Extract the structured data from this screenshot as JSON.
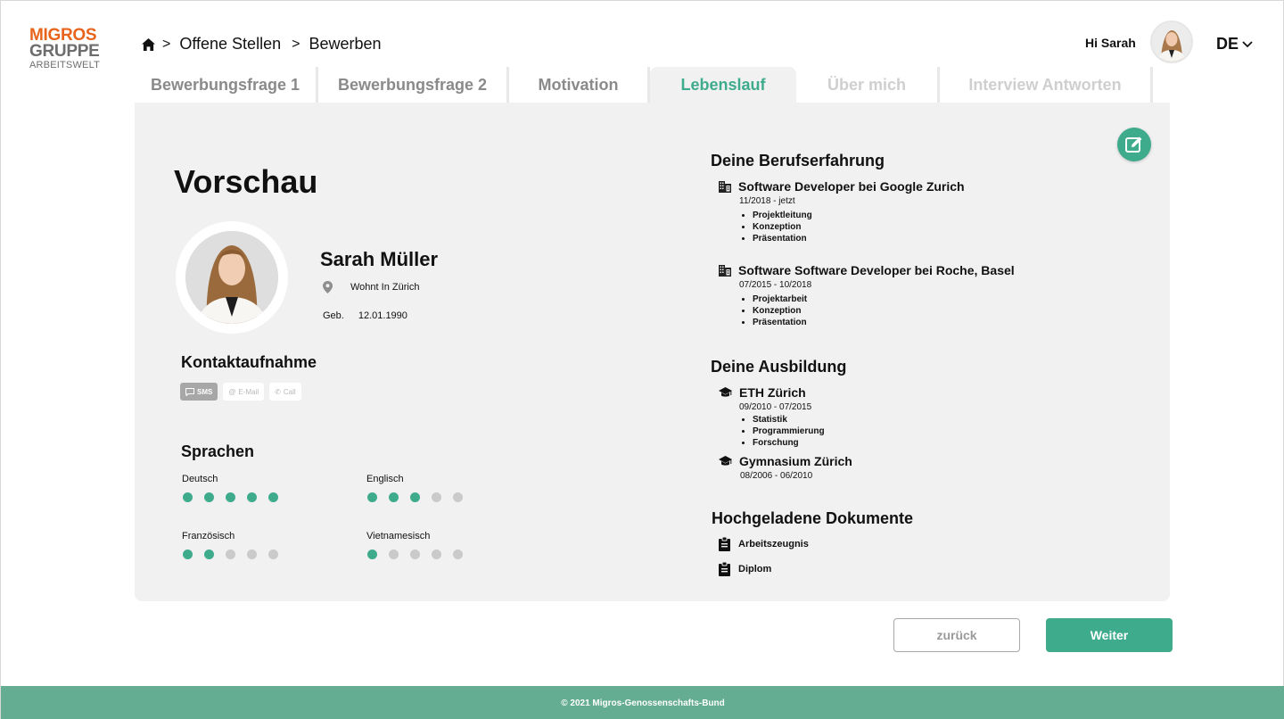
{
  "logo": {
    "line1": "MIGROS",
    "line2": "GRUPPE",
    "line3": "ARBEITSWELT",
    "brand_color": "#e8641c"
  },
  "breadcrumb": {
    "home_icon": "home-icon",
    "items": [
      "Offene Stellen",
      "Bewerben"
    ],
    "separator": ">"
  },
  "header": {
    "greeting": "Hi Sarah",
    "language": "DE"
  },
  "tabs": [
    {
      "label": "Bewerbungsfrage 1",
      "state": "done"
    },
    {
      "label": "Bewerbungsfrage 2",
      "state": "done"
    },
    {
      "label": "Motivation",
      "state": "done"
    },
    {
      "label": "Lebenslauf",
      "state": "active"
    },
    {
      "label": "Über mich",
      "state": "disabled"
    },
    {
      "label": "Interview Antworten",
      "state": "disabled"
    }
  ],
  "preview": {
    "title": "Vorschau",
    "name": "Sarah Müller",
    "location": "Wohnt In Zürich",
    "birth_label": "Geb.",
    "birth_date": "12.01.1990"
  },
  "contact": {
    "heading": "Kontaktaufnahme",
    "options": [
      {
        "label": "SMS",
        "icon": "chat-icon",
        "selected": true
      },
      {
        "label": "E-Mail",
        "icon": "at-icon",
        "selected": false
      },
      {
        "label": "Call",
        "icon": "phone-icon",
        "selected": false
      }
    ]
  },
  "languages": {
    "heading": "Sprachen",
    "max_level": 5,
    "items": [
      {
        "name": "Deutsch",
        "level": 5
      },
      {
        "name": "Englisch",
        "level": 3
      },
      {
        "name": "Französisch",
        "level": 2
      },
      {
        "name": "Vietnamesisch",
        "level": 1
      }
    ]
  },
  "experience": {
    "heading": "Deine Berufserfahrung",
    "items": [
      {
        "title": "Software Developer bei Google Zurich",
        "dates": "11/2018 - jetzt",
        "bullets": [
          "Projektleitung",
          "Konzeption",
          "Präsentation"
        ]
      },
      {
        "title": "Software Software Developer bei Roche, Basel",
        "dates": "07/2015 - 10/2018",
        "bullets": [
          "Projektarbeit",
          "Konzeption",
          "Präsentation"
        ]
      }
    ]
  },
  "education": {
    "heading": "Deine Ausbildung",
    "items": [
      {
        "title": "ETH Zürich",
        "dates": "09/2010 - 07/2015",
        "bullets": [
          "Statistik",
          "Programmierung",
          "Forschung"
        ]
      },
      {
        "title": "Gymnasium Zürich",
        "dates": "08/2006 - 06/2010",
        "bullets": []
      }
    ]
  },
  "documents": {
    "heading": "Hochgeladene Dokumente",
    "items": [
      "Arbeitszeugnis",
      "Diplom"
    ]
  },
  "actions": {
    "back_label": "zurück",
    "next_label": "Weiter"
  },
  "footer": {
    "text": "© 2021 Migros-Genossenschafts-Bund"
  },
  "colors": {
    "accent": "#3fab8d",
    "footer": "#64ad92",
    "card": "#f1f1f1"
  }
}
